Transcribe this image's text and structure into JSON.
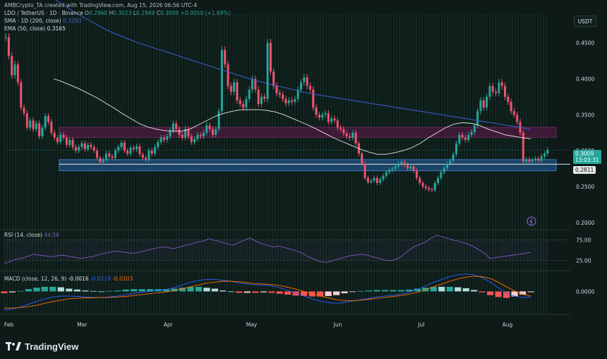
{
  "header": {
    "credit": "AMBCrypto_TA created with TradingView.com, Aug 15, 2026 06:56 UTC-4",
    "symbol": "LDO / TetherUS · 1D · Binance",
    "ohlc": {
      "o_label": "O",
      "o": "0.2960",
      "h_label": "H",
      "h": "0.3023",
      "l_label": "L",
      "l": "0.2949",
      "c_label": "C",
      "c": "0.3009",
      "change": "+0.0050 (+1.69%)"
    },
    "sma_label": "SMA · 1D (200, close)",
    "sma_value": "0.3293",
    "ema_label": "EMA (50, close)",
    "ema_value": "0.3165"
  },
  "currency_button": "USDT",
  "price_tag": {
    "price": "0.3009",
    "countdown": "13:03:31"
  },
  "support_tag": "0.2811",
  "rsi_label": "RSI (14, close)",
  "rsi_value": "44.56",
  "macd_label": "MACD (close, 12, 26, 9)",
  "macd_values": [
    "-0.0016",
    "-0.0119",
    "-0.0103"
  ],
  "footer_brand": "TradingView",
  "colors": {
    "background": "#0d1a17",
    "candle_up": "#26a69a",
    "candle_down": "#ef5370",
    "sma": "#3d5fd6",
    "ema": "#e6e6e6",
    "rsi": "#7e57c2",
    "resistance_zone": "#4a1a3d",
    "support_zone": "#1f4e7a",
    "macd_line": "#2962ff",
    "signal_line": "#ff6d00"
  },
  "chart_data": [
    {
      "type": "candlestick",
      "series_name": "LDO / TetherUS",
      "ylim": [
        0.19,
        0.49
      ],
      "y_ticks": [
        0.45,
        0.4,
        0.35,
        0.3,
        0.25,
        0.2
      ],
      "y_tick_labels": [
        "0.4500",
        "0.4000",
        "0.3500",
        "0.3000",
        "0.2500",
        "0.2000"
      ],
      "x_tick_labels": [
        "Feb",
        "Mar",
        "Apr",
        "May",
        "Jun",
        "Jul",
        "Aug"
      ],
      "x_tick_days": [
        0,
        28,
        59,
        89,
        120,
        150,
        181
      ],
      "close": [
        0.458,
        0.432,
        0.405,
        0.42,
        0.395,
        0.36,
        0.352,
        0.332,
        0.342,
        0.33,
        0.338,
        0.32,
        0.332,
        0.348,
        0.34,
        0.325,
        0.318,
        0.312,
        0.322,
        0.318,
        0.308,
        0.315,
        0.305,
        0.3,
        0.305,
        0.31,
        0.302,
        0.308,
        0.305,
        0.3,
        0.29,
        0.284,
        0.288,
        0.296,
        0.292,
        0.29,
        0.3,
        0.305,
        0.311,
        0.3,
        0.296,
        0.304,
        0.302,
        0.306,
        0.295,
        0.29,
        0.288,
        0.3,
        0.296,
        0.305,
        0.312,
        0.318,
        0.315,
        0.32,
        0.328,
        0.338,
        0.33,
        0.322,
        0.318,
        0.33,
        0.32,
        0.312,
        0.316,
        0.322,
        0.32,
        0.325,
        0.335,
        0.33,
        0.322,
        0.33,
        0.355,
        0.44,
        0.42,
        0.39,
        0.382,
        0.395,
        0.37,
        0.365,
        0.36,
        0.372,
        0.385,
        0.4,
        0.385,
        0.365,
        0.375,
        0.372,
        0.45,
        0.41,
        0.39,
        0.38,
        0.378,
        0.372,
        0.366,
        0.37,
        0.368,
        0.372,
        0.385,
        0.395,
        0.402,
        0.39,
        0.385,
        0.36,
        0.35,
        0.346,
        0.35,
        0.352,
        0.34,
        0.345,
        0.342,
        0.332,
        0.33,
        0.324,
        0.32,
        0.318,
        0.325,
        0.31,
        0.296,
        0.282,
        0.262,
        0.256,
        0.258,
        0.262,
        0.255,
        0.26,
        0.265,
        0.27,
        0.273,
        0.275,
        0.278,
        0.282,
        0.284,
        0.28,
        0.275,
        0.278,
        0.272,
        0.262,
        0.255,
        0.25,
        0.248,
        0.246,
        0.245,
        0.255,
        0.262,
        0.27,
        0.276,
        0.282,
        0.286,
        0.295,
        0.31,
        0.322,
        0.318,
        0.315,
        0.322,
        0.326,
        0.335,
        0.355,
        0.37,
        0.36,
        0.375,
        0.39,
        0.382,
        0.38,
        0.395,
        0.39,
        0.375,
        0.368,
        0.355,
        0.35,
        0.34,
        0.325,
        0.285,
        0.288,
        0.285,
        0.287,
        0.289,
        0.286,
        0.292,
        0.296,
        0.3009
      ],
      "sma_200": [
        0.555,
        0.548,
        0.54,
        0.532,
        0.524,
        0.516,
        0.508,
        0.5,
        0.492,
        0.485,
        0.478,
        0.471,
        0.465,
        0.46,
        0.455,
        0.45,
        0.446,
        0.442,
        0.438,
        0.434,
        0.43,
        0.426,
        0.422,
        0.418,
        0.414,
        0.41,
        0.406,
        0.402,
        0.398,
        0.395,
        0.392,
        0.389,
        0.386,
        0.383,
        0.38,
        0.378,
        0.376,
        0.374,
        0.372,
        0.37,
        0.368,
        0.366,
        0.364,
        0.362,
        0.36,
        0.358,
        0.356,
        0.354,
        0.352,
        0.35,
        0.348,
        0.346,
        0.344,
        0.342,
        0.34,
        0.338,
        0.336,
        0.334,
        0.332,
        0.3293
      ],
      "ema_50": [
        0.4,
        0.396,
        0.391,
        0.386,
        0.38,
        0.374,
        0.367,
        0.36,
        0.352,
        0.345,
        0.338,
        0.333,
        0.33,
        0.328,
        0.327,
        0.327,
        0.33,
        0.336,
        0.342,
        0.348,
        0.352,
        0.355,
        0.357,
        0.357,
        0.357,
        0.356,
        0.354,
        0.35,
        0.345,
        0.34,
        0.335,
        0.329,
        0.323,
        0.317,
        0.312,
        0.307,
        0.302,
        0.298,
        0.295,
        0.295,
        0.297,
        0.3,
        0.304,
        0.31,
        0.318,
        0.325,
        0.332,
        0.337,
        0.339,
        0.338,
        0.335,
        0.33,
        0.326,
        0.322,
        0.32,
        0.318,
        0.3165
      ],
      "zones": [
        {
          "name": "resistance",
          "from": 0.3325,
          "to": 0.3185,
          "color_key": "resistance_zone"
        },
        {
          "name": "support",
          "from": 0.2875,
          "to": 0.272,
          "color_key": "support_zone"
        }
      ],
      "support_line": 0.2811
    },
    {
      "type": "line",
      "series_name": "RSI (14, close)",
      "ylim": [
        0,
        100
      ],
      "y_ticks": [
        75,
        25
      ],
      "y_tick_labels": [
        "75.00",
        "25.00"
      ],
      "values": [
        18,
        22,
        28,
        30,
        35,
        40,
        38,
        36,
        34,
        36,
        38,
        35,
        33,
        30,
        32,
        34,
        38,
        42,
        45,
        48,
        46,
        44,
        42,
        45,
        48,
        52,
        55,
        58,
        56,
        54,
        58,
        62,
        65,
        70,
        72,
        78,
        74,
        70,
        66,
        62,
        68,
        74,
        80,
        72,
        66,
        62,
        58,
        60,
        56,
        52,
        48,
        42,
        34,
        28,
        22,
        20,
        24,
        28,
        32,
        36,
        38,
        40,
        38,
        34,
        30,
        26,
        24,
        28,
        36,
        48,
        58,
        64,
        70,
        80,
        86,
        82,
        78,
        74,
        70,
        66,
        60,
        52,
        44,
        30,
        32,
        34,
        36,
        38,
        40,
        42,
        44.56
      ]
    },
    {
      "type": "macd",
      "series_name": "MACD (close, 12, 26, 9)",
      "ylim": [
        -0.05,
        0.045
      ],
      "y_ticks": [
        0
      ],
      "y_tick_labels": [
        "0.0000"
      ],
      "macd": [
        -0.04,
        -0.038,
        -0.034,
        -0.028,
        -0.022,
        -0.016,
        -0.012,
        -0.01,
        -0.01,
        -0.011,
        -0.012,
        -0.013,
        -0.013,
        -0.012,
        -0.01,
        -0.007,
        -0.004,
        -0.002,
        0.0,
        0.002,
        0.004,
        0.008,
        0.014,
        0.02,
        0.024,
        0.026,
        0.026,
        0.024,
        0.022,
        0.018,
        0.016,
        0.014,
        0.014,
        0.012,
        0.008,
        0.002,
        -0.004,
        -0.01,
        -0.016,
        -0.021,
        -0.024,
        -0.026,
        -0.024,
        -0.021,
        -0.018,
        -0.015,
        -0.012,
        -0.01,
        -0.008,
        -0.006,
        -0.002,
        0.004,
        0.012,
        0.02,
        0.026,
        0.032,
        0.036,
        0.038,
        0.036,
        0.03,
        0.02,
        0.008,
        -0.004,
        -0.01,
        -0.013,
        -0.0119
      ],
      "signal": [
        -0.036,
        -0.036,
        -0.035,
        -0.033,
        -0.03,
        -0.026,
        -0.022,
        -0.019,
        -0.016,
        -0.015,
        -0.014,
        -0.014,
        -0.013,
        -0.013,
        -0.012,
        -0.011,
        -0.009,
        -0.007,
        -0.005,
        -0.003,
        -0.001,
        0.002,
        0.006,
        0.01,
        0.014,
        0.018,
        0.02,
        0.022,
        0.022,
        0.021,
        0.019,
        0.017,
        0.016,
        0.015,
        0.013,
        0.009,
        0.005,
        0.0,
        -0.005,
        -0.01,
        -0.014,
        -0.018,
        -0.02,
        -0.02,
        -0.019,
        -0.017,
        -0.015,
        -0.013,
        -0.011,
        -0.009,
        -0.006,
        -0.002,
        0.004,
        0.01,
        0.016,
        0.022,
        0.027,
        0.031,
        0.033,
        0.032,
        0.028,
        0.02,
        0.01,
        0.001,
        -0.006,
        -0.0103
      ]
    }
  ]
}
